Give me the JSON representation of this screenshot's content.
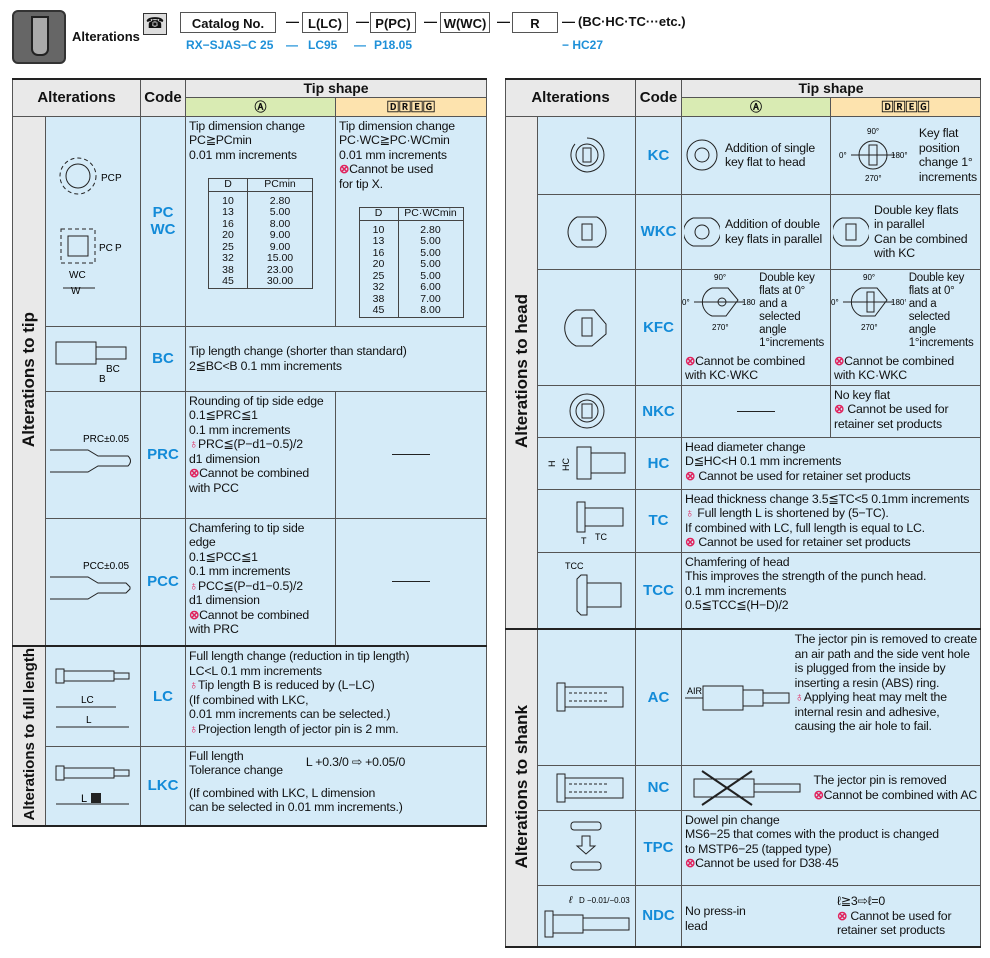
{
  "header": {
    "title": "Alterations",
    "catalog_no": "Catalog No.",
    "l": "L(LC)",
    "p": "P(PC)",
    "w": "W(WC)",
    "r": "R",
    "suffix": "(BC·HC·TC···etc.)",
    "dash": "—",
    "ex_catalog": "RX−SJAS−C 25",
    "ex_sep1": "—",
    "ex_l": "LC95",
    "ex_sep2": "—",
    "ex_p": "P18.05",
    "ex_r": "− HC27",
    "icons": [
      "tool-icon",
      "phone-fax-icon"
    ]
  },
  "colors": {
    "code": "#138bd8",
    "cell": "#d5ebf8",
    "tipA": "#d9ebb3",
    "tipDREG": "#fde3ae",
    "warn": "#e0245e"
  },
  "columns": {
    "alterations": "Alterations",
    "code": "Code",
    "tip_shape": "Tip shape",
    "tip_a": "Ⓐ",
    "tip_dreg": "🄳🅁🄴🄶"
  },
  "left": {
    "group_tip": "Alterations to tip",
    "group_length": "Alterations to full length",
    "pc": {
      "code": "PC\nWC",
      "a": "Tip dimension change\nPC≧PCmin\n0.01 mm increments",
      "dreg": "Tip dimension change\nPC·WC≧PC·WCmin\n0.01 mm increments\n⊗Cannot be used\n   for tip X.",
      "table_a": {
        "headers": [
          "D",
          "PCmin"
        ],
        "rows": [
          [
            "10",
            "2.80"
          ],
          [
            "13",
            "5.00"
          ],
          [
            "16",
            "8.00"
          ],
          [
            "20",
            "9.00"
          ],
          [
            "25",
            "9.00"
          ],
          [
            "32",
            "15.00"
          ],
          [
            "38",
            "23.00"
          ],
          [
            "45",
            "30.00"
          ]
        ]
      },
      "table_dreg": {
        "headers": [
          "D",
          "PC·WCmin"
        ],
        "rows": [
          [
            "10",
            "2.80"
          ],
          [
            "13",
            "5.00"
          ],
          [
            "16",
            "5.00"
          ],
          [
            "20",
            "5.00"
          ],
          [
            "25",
            "5.00"
          ],
          [
            "32",
            "6.00"
          ],
          [
            "38",
            "7.00"
          ],
          [
            "45",
            "8.00"
          ]
        ]
      },
      "img_labels": [
        "PC",
        "P",
        "PC",
        "P",
        "WC",
        "W"
      ]
    },
    "bc": {
      "code": "BC",
      "text": "Tip length change (shorter than standard)\n2≦BC<B                         0.1 mm increments",
      "img_labels": [
        "BC",
        "B"
      ]
    },
    "prc": {
      "code": "PRC",
      "a": "Rounding of tip side edge\n0.1≦PRC≦1\n0.1 mm increments\n♁PRC≦(P−d1−0.5)/2\n   d1 dimension\n⊗Cannot be combined\n   with PCC",
      "img_label": "PRC±0.05"
    },
    "pcc": {
      "code": "PCC",
      "a": "Chamfering to tip side edge\n0.1≦PCC≦1\n0.1 mm increments\n♁PCC≦(P−d1−0.5)/2\n   d1 dimension\n⊗Cannot be combined\n   with PRC",
      "img_label": "PCC±0.05"
    },
    "lc": {
      "code": "LC",
      "text": "Full length change (reduction in tip length)\nLC<L                              0.1 mm increments\n♁Tip length B is reduced by (L−LC)\n(If combined with LKC,\n0.01 mm increments can be selected.)\n♁Projection length of jector pin is 2 mm.",
      "img_labels": [
        "LC",
        "L"
      ]
    },
    "lkc": {
      "code": "LKC",
      "text1": "Full length\nTolerance change",
      "tol": "L +0.3/0 ⇨ +0.05/0",
      "text2": "(If combined with LKC, L dimension\ncan be selected in 0.01 mm increments.)",
      "img_label": "L"
    }
  },
  "right": {
    "group_head": "Alterations to head",
    "group_shank": "Alterations to shank",
    "kc": {
      "code": "KC",
      "a": "Addition of single\nkey flat to head",
      "dreg": "Key flat\nposition\nchange 1°\nincrements",
      "angles": [
        "90°",
        "0°",
        "180°",
        "270°"
      ]
    },
    "wkc": {
      "code": "WKC",
      "a": "Addition of double\nkey flats in parallel",
      "dreg": "Double key flats\nin parallel\nCan be combined\nwith KC"
    },
    "kfc": {
      "code": "KFC",
      "a": "Double key\nflats at 0°\nand  a\nselected angle\n1°increments",
      "a_note": "⊗Cannot be combined\n   with KC·WKC",
      "dreg": "Double key\nflats at 0°\nand  a\nselected angle\n1°increments",
      "dreg_note": "⊗Cannot be combined\n   with KC·WKC"
    },
    "nkc": {
      "code": "NKC",
      "dreg": "No key flat\n⊗ Cannot be used for\n   retainer set products"
    },
    "hc": {
      "code": "HC",
      "text": "Head diameter change\nD≦HC<H                  0.1 mm increments\n⊗ Cannot be used for retainer set products",
      "img_labels": [
        "H",
        "HC"
      ]
    },
    "tc": {
      "code": "TC",
      "text": "Head thickness change 3.5≦TC<5  0.1mm increments\n♁ Full length L is shortened by (5−TC).\n   If combined with LC, full length is equal to LC.\n⊗ Cannot be used for retainer set products",
      "img_labels": [
        "TC",
        "T"
      ]
    },
    "tcc": {
      "code": "TCC",
      "text": "Chamfering of head\nThis improves the strength of the punch head.\n0.1 mm increments\n0.5≦TCC≦(H−D)/2",
      "img_label": "TCC"
    },
    "ac": {
      "code": "AC",
      "text": "The jector pin is removed to create\nan air path and the side vent hole\nis plugged from the inside by\ninserting a resin (ABS) ring.\n♁Applying heat may melt the\n  internal resin and adhesive,\n  causing the air hole to fail.",
      "img_label": "AIR"
    },
    "nc": {
      "code": "NC",
      "text": "The jector pin is removed\n⊗Cannot be combined with AC"
    },
    "tpc": {
      "code": "TPC",
      "text": "Dowel pin change\nMS6−25 that comes with the product is changed\nto MSTP6−25 (tapped type)\n⊗Cannot be used for D38·45"
    },
    "ndc": {
      "code": "NDC",
      "text1": "No press-in\nlead",
      "text2": "ℓ≧3⇨ℓ=0\n⊗ Cannot be used for\n   retainer set products",
      "img_labels": [
        "ℓ",
        "D −0.01/−0.03"
      ]
    }
  }
}
